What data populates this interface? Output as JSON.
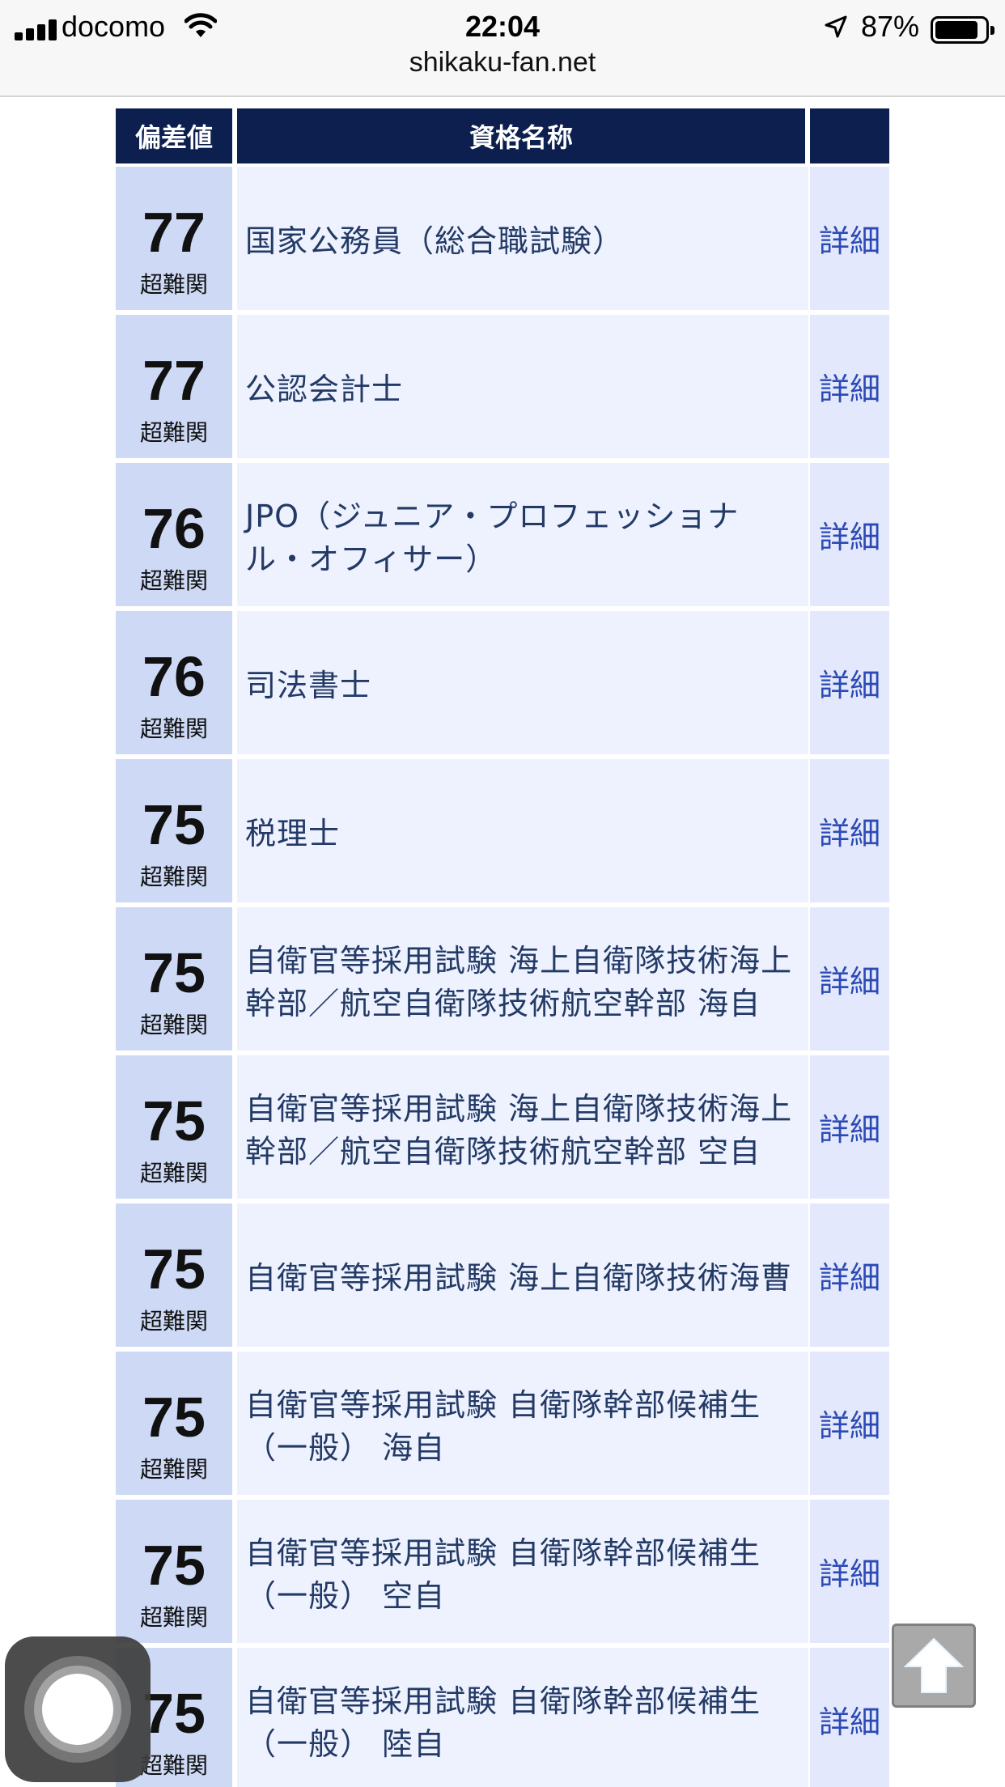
{
  "status_bar": {
    "carrier": "docomo",
    "time": "22:04",
    "battery_percent": "87%",
    "battery_level": 0.87
  },
  "browser": {
    "url": "shikaku-fan.net"
  },
  "table": {
    "headers": {
      "score": "偏差値",
      "name": "資格名称",
      "detail": ""
    },
    "rows": [
      {
        "score": "77",
        "level": "超難関",
        "name": "国家公務員（総合職試験）",
        "detail": "詳細"
      },
      {
        "score": "77",
        "level": "超難関",
        "name": "公認会計士",
        "detail": "詳細"
      },
      {
        "score": "76",
        "level": "超難関",
        "name": "JPO（ジュニア・プロフェッショナル・オフィサー）",
        "detail": "詳細"
      },
      {
        "score": "76",
        "level": "超難関",
        "name": "司法書士",
        "detail": "詳細"
      },
      {
        "score": "75",
        "level": "超難関",
        "name": "税理士",
        "detail": "詳細"
      },
      {
        "score": "75",
        "level": "超難関",
        "name": "自衛官等採用試験 海上自衛隊技術海上幹部／航空自衛隊技術航空幹部 海自",
        "detail": "詳細"
      },
      {
        "score": "75",
        "level": "超難関",
        "name": "自衛官等採用試験 海上自衛隊技術海上幹部／航空自衛隊技術航空幹部 空自",
        "detail": "詳細"
      },
      {
        "score": "75",
        "level": "超難関",
        "name": "自衛官等採用試験 海上自衛隊技術海曹",
        "detail": "詳細"
      },
      {
        "score": "75",
        "level": "超難関",
        "name": "自衛官等採用試験 自衛隊幹部候補生（一般） 海自",
        "detail": "詳細"
      },
      {
        "score": "75",
        "level": "超難関",
        "name": "自衛官等採用試験 自衛隊幹部候補生（一般） 空自",
        "detail": "詳細"
      },
      {
        "score": "75",
        "level": "超難関",
        "name": "自衛官等採用試験 自衛隊幹部候補生（一般） 陸自",
        "detail": "詳細"
      }
    ]
  },
  "icons": {
    "scroll_top": "arrow-up-icon",
    "assistive_touch": "assistive-touch-icon"
  }
}
